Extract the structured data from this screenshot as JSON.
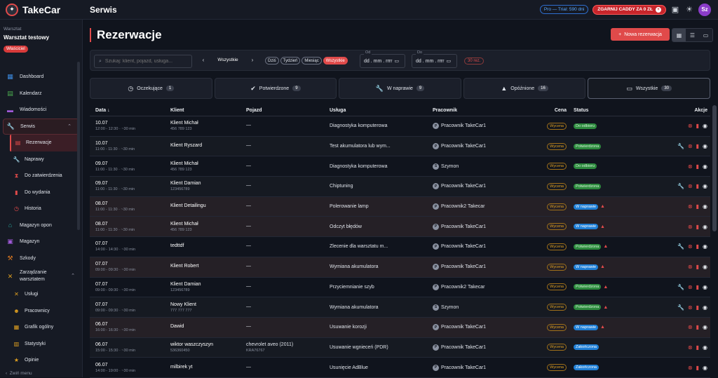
{
  "app": {
    "name": "TakeCar",
    "section": "Serwis"
  },
  "topbar": {
    "trial": "Pro — Trial: 590 dni",
    "promo": "ZGARNIJ CADDY ZA 0 ZŁ",
    "avatar": "Sz"
  },
  "sidebar": {
    "workspace_label": "Warsztat",
    "workspace_name": "Warsztat testowy",
    "role_badge": "Właściciel",
    "items": [
      {
        "label": "Dashboard",
        "icon": "dashboard-icon",
        "color": "#3d8be0"
      },
      {
        "label": "Kalendarz",
        "icon": "calendar-icon",
        "color": "#4caf50"
      },
      {
        "label": "Wiadomości",
        "icon": "message-icon",
        "color": "#a05ad8"
      },
      {
        "label": "Serwis",
        "icon": "wrench-icon",
        "color": "#e04a4a"
      },
      {
        "label": "Rezerwacje",
        "icon": "calendar-icon",
        "color": "#e04a4a"
      },
      {
        "label": "Naprawy",
        "icon": "wrench-icon",
        "color": "#e04a4a"
      },
      {
        "label": "Do zatwierdzenia",
        "icon": "hourglass-icon",
        "color": "#e04a4a"
      },
      {
        "label": "Do wydania",
        "icon": "clipboard-icon",
        "color": "#e04a4a"
      },
      {
        "label": "Historia",
        "icon": "history-icon",
        "color": "#e04a4a"
      },
      {
        "label": "Magazyn opon",
        "icon": "warehouse-icon",
        "color": "#26a69a"
      },
      {
        "label": "Magazyn",
        "icon": "box-icon",
        "color": "#a05ad8"
      },
      {
        "label": "Szkody",
        "icon": "hammer-icon",
        "color": "#e07a20"
      },
      {
        "label": "Zarządzanie warsztatem",
        "icon": "tools-icon",
        "color": "#e0a020"
      },
      {
        "label": "Usługi",
        "icon": "tools-icon",
        "color": "#e0a020"
      },
      {
        "label": "Pracownicy",
        "icon": "people-icon",
        "color": "#e0a020"
      },
      {
        "label": "Grafik ogólny",
        "icon": "schedule-icon",
        "color": "#e0a020"
      },
      {
        "label": "Statystyki",
        "icon": "stats-icon",
        "color": "#e0a020"
      },
      {
        "label": "Opinie",
        "icon": "star-icon",
        "color": "#e0a020"
      }
    ],
    "collapse": "Zwiń menu"
  },
  "main": {
    "title": "Rezerwacje",
    "new_button": "Nowa rezerwacja",
    "search_placeholder": "Szukaj: klient, pojazd, usługa...",
    "range_label": "Wszystkie",
    "chips": [
      "Dziś",
      "Tydzień",
      "Miesiąc",
      "Wszystkie"
    ],
    "date_from_label": "Od",
    "date_to_label": "Do",
    "date_placeholder": "dd . mm . rrrr",
    "result_count": "30 rez.",
    "tabs": [
      {
        "label": "Oczekujące",
        "count": "1",
        "icon": "clock-icon"
      },
      {
        "label": "Potwierdzone",
        "count": "9",
        "icon": "check-circle-icon"
      },
      {
        "label": "W naprawie",
        "count": "9",
        "icon": "wrench-icon"
      },
      {
        "label": "Opóźnione",
        "count": "16",
        "icon": "warning-icon"
      },
      {
        "label": "Wszystkie",
        "count": "30",
        "icon": "calendar-icon"
      }
    ],
    "columns": [
      "Data",
      "Klient",
      "Pojazd",
      "Usługa",
      "Pracownik",
      "Cena",
      "Status",
      "Akcje"
    ],
    "rows": [
      {
        "date": "10.07",
        "time": "12:00 - 12:30 · ~30 min",
        "client": "Klient Michał",
        "phone": "456 789 123",
        "vehicle": "—",
        "plate": "",
        "service": "Diagnostyka komputerowa",
        "worker": "Pracownik TakeCar1",
        "worker_initial": "P",
        "price": "Wycena",
        "status": "Do odbioru",
        "status_color": "green",
        "warn": false,
        "wrench": false
      },
      {
        "date": "10.07",
        "time": "11:00 - 11:30 · ~30 min",
        "client": "Klient Ryszard",
        "phone": "",
        "vehicle": "—",
        "plate": "",
        "service": "Test akumulatora lub wym...",
        "worker": "Pracownik TakeCar1",
        "worker_initial": "P",
        "price": "Wycena",
        "status": "Potwierdzona",
        "status_color": "green",
        "warn": false,
        "wrench": true
      },
      {
        "date": "09.07",
        "time": "11:00 - 11:30 · ~30 min",
        "client": "Klient Michał",
        "phone": "456 789 123",
        "vehicle": "—",
        "plate": "",
        "service": "Diagnostyka komputerowa",
        "worker": "Szymon",
        "worker_initial": "S",
        "price": "Wycena",
        "status": "Do odbioru",
        "status_color": "green",
        "warn": false,
        "wrench": false
      },
      {
        "date": "09.07",
        "time": "11:00 - 11:30 · ~30 min",
        "client": "Klient Damian",
        "phone": "123456789",
        "vehicle": "—",
        "plate": "",
        "service": "Chiptuning",
        "worker": "Pracownik TakeCar1",
        "worker_initial": "P",
        "price": "Wycena",
        "status": "Potwierdzona",
        "status_color": "green",
        "warn": false,
        "wrench": true
      },
      {
        "date": "08.07",
        "time": "11:00 - 11:30 · ~30 min",
        "client": "Klient Detailingu",
        "phone": "",
        "vehicle": "—",
        "plate": "",
        "service": "Polerowanie lamp",
        "worker": "Pracownik2 Takecar",
        "worker_initial": "P",
        "price": "Wycena",
        "status": "W naprawie",
        "status_color": "blue",
        "warn": true,
        "wrench": false
      },
      {
        "date": "08.07",
        "time": "11:00 - 11:30 · ~30 min",
        "client": "Klient Michał",
        "phone": "456 789 123",
        "vehicle": "—",
        "plate": "",
        "service": "Odczyt błędów",
        "worker": "Pracownik TakeCar1",
        "worker_initial": "P",
        "price": "Wycena",
        "status": "W naprawie",
        "status_color": "blue",
        "warn": true,
        "wrench": false
      },
      {
        "date": "07.07",
        "time": "14:00 - 14:30 · ~30 min",
        "client": "tedttdf",
        "phone": "",
        "vehicle": "—",
        "plate": "",
        "service": "Zlecenie dla warsztatu m...",
        "worker": "Pracownik TakeCar1",
        "worker_initial": "P",
        "price": "Wycena",
        "status": "Potwierdzona",
        "status_color": "green",
        "warn": true,
        "wrench": true
      },
      {
        "date": "07.07",
        "time": "09:00 - 09:30 · ~30 min",
        "client": "Klient Robert",
        "phone": "",
        "vehicle": "—",
        "plate": "",
        "service": "Wymiana akumulatora",
        "worker": "Pracownik TakeCar1",
        "worker_initial": "P",
        "price": "Wycena",
        "status": "W naprawie",
        "status_color": "blue",
        "warn": true,
        "wrench": false
      },
      {
        "date": "07.07",
        "time": "09:00 - 09:30 · ~30 min",
        "client": "Klient Damian",
        "phone": "123456789",
        "vehicle": "—",
        "plate": "",
        "service": "Przyciemnianie szyb",
        "worker": "Pracownik2 Takecar",
        "worker_initial": "P",
        "price": "Wycena",
        "status": "Potwierdzona",
        "status_color": "green",
        "warn": true,
        "wrench": true
      },
      {
        "date": "07.07",
        "time": "09:00 - 09:30 · ~30 min",
        "client": "Nowy Klient",
        "phone": "777 777 777",
        "vehicle": "—",
        "plate": "",
        "service": "Wymiana akumulatora",
        "worker": "Szymon",
        "worker_initial": "S",
        "price": "Wycena",
        "status": "Potwierdzona",
        "status_color": "green",
        "warn": true,
        "wrench": true
      },
      {
        "date": "06.07",
        "time": "16:00 - 16:30 · ~30 min",
        "client": "Dawid",
        "phone": "",
        "vehicle": "—",
        "plate": "",
        "service": "Usuwanie korozji",
        "worker": "Pracownik TakeCar1",
        "worker_initial": "P",
        "price": "Wycena",
        "status": "W naprawie",
        "status_color": "blue",
        "warn": true,
        "wrench": false
      },
      {
        "date": "06.07",
        "time": "15:00 - 15:30 · ~30 min",
        "client": "wiktor waszczyszyn",
        "phone": "536360450",
        "vehicle": "chevrolet aveo (2011)",
        "plate": "KRA76767",
        "service": "Usuwanie wgnieceń (PDR)",
        "worker": "Pracownik TakeCar1",
        "worker_initial": "P",
        "price": "Wycena",
        "status": "Zakończona",
        "status_color": "blue",
        "warn": false,
        "wrench": false
      },
      {
        "date": "06.07",
        "time": "14:00 - 19:00 · ~30 min",
        "client": "milbirek yt",
        "phone": "",
        "vehicle": "—",
        "plate": "",
        "service": "Usunięcie AdBlue",
        "worker": "Pracownik TakeCar1",
        "worker_initial": "P",
        "price": "Wycena",
        "status": "Zakończona",
        "status_color": "blue",
        "warn": false,
        "wrench": false
      }
    ]
  }
}
